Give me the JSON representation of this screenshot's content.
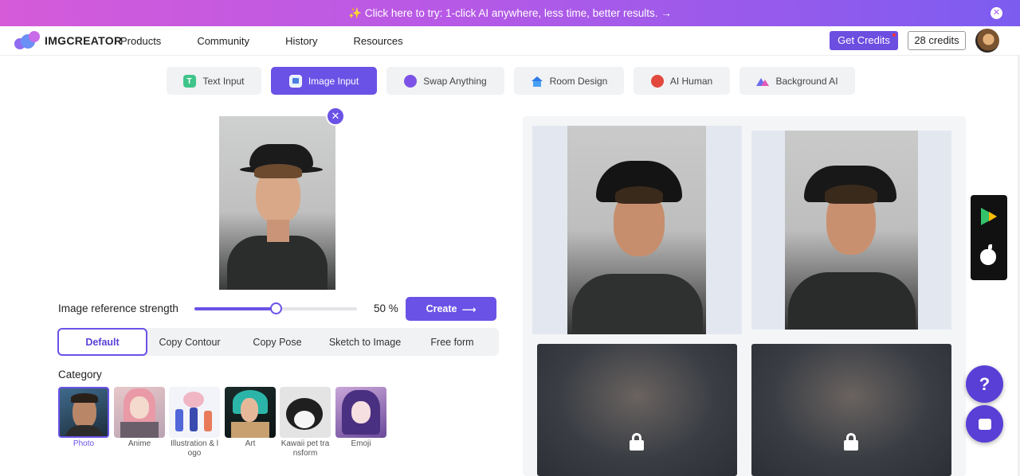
{
  "banner": {
    "text": "✨ Click here to try: 1-click AI anywhere, less time, better results. →",
    "close_icon": "close-icon"
  },
  "header": {
    "logo_text": "IMGCREATOR",
    "nav": [
      "Products",
      "Community",
      "History",
      "Resources"
    ],
    "get_credits_label": "Get Credits",
    "credits_label": "28 credits"
  },
  "modes": [
    {
      "label": "Text Input",
      "icon": "text-icon",
      "active": false
    },
    {
      "label": "Image Input",
      "icon": "image-icon",
      "active": true
    },
    {
      "label": "Swap Anything",
      "icon": "swap-icon",
      "active": false
    },
    {
      "label": "Room Design",
      "icon": "house-icon",
      "active": false
    },
    {
      "label": "AI Human",
      "icon": "human-icon",
      "active": false
    },
    {
      "label": "Background AI",
      "icon": "mountain-icon",
      "active": false
    }
  ],
  "controls": {
    "strength_label": "Image reference strength",
    "strength_value": 50,
    "strength_text": "50 %",
    "create_label": "Create",
    "control_tabs": [
      "Default",
      "Copy Contour",
      "Copy Pose",
      "Sketch to Image",
      "Free form"
    ],
    "active_control_tab": "Default",
    "category_label": "Category",
    "categories": [
      {
        "label": "Photo",
        "active": true
      },
      {
        "label": "Anime",
        "active": false
      },
      {
        "label": "Illustration & logo",
        "active": false
      },
      {
        "label": "Art",
        "active": false
      },
      {
        "label": "Kawaii pet transform",
        "active": false
      },
      {
        "label": "Emoji",
        "active": false
      }
    ]
  },
  "results": {
    "items": [
      {
        "state": "generated"
      },
      {
        "state": "generated"
      },
      {
        "state": "locked"
      },
      {
        "state": "locked"
      }
    ]
  },
  "colors": {
    "accent": "#6b52e6",
    "banner_start": "#d55bd9",
    "banner_end": "#7c5cf0"
  }
}
